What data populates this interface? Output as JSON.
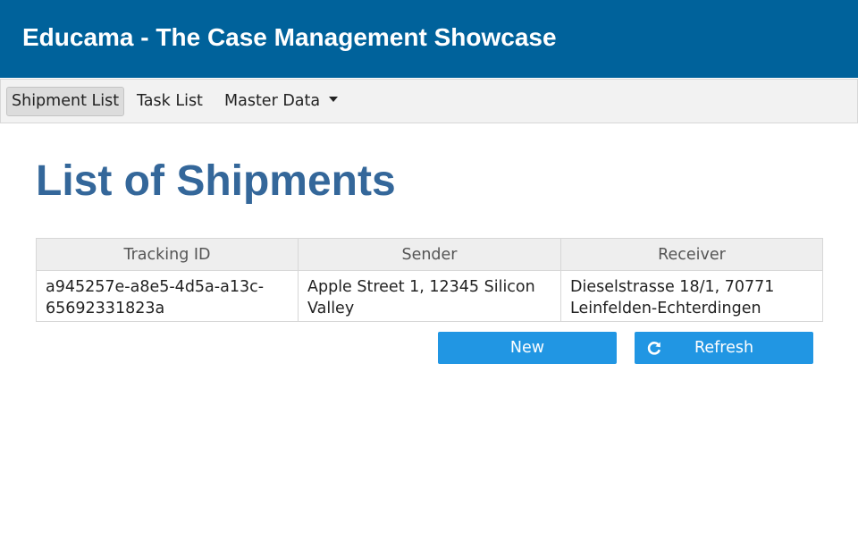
{
  "header": {
    "title": "Educama - The Case Management Showcase"
  },
  "menu": {
    "items": [
      {
        "label": "Shipment List",
        "active": true
      },
      {
        "label": "Task List",
        "active": false
      },
      {
        "label": "Master Data",
        "active": false,
        "dropdown": true
      }
    ]
  },
  "main": {
    "title": "List of Shipments",
    "table": {
      "columns": [
        "Tracking ID",
        "Sender",
        "Receiver"
      ],
      "rows": [
        {
          "tracking_id": "a945257e-a8e5-4d5a-a13c-65692331823a",
          "sender": "Apple Street 1, 12345 Silicon Valley",
          "receiver": "Dieselstrasse 18/1, 70771 Leinfelden-Echterdingen"
        }
      ]
    },
    "buttons": {
      "new_label": "New",
      "refresh_label": "Refresh"
    }
  },
  "colors": {
    "header_bg": "#00629b",
    "title_color": "#34679a",
    "button_bg": "#2196e3"
  },
  "icons": {
    "menu_dropdown": "caret-down-icon",
    "refresh": "refresh-icon"
  }
}
